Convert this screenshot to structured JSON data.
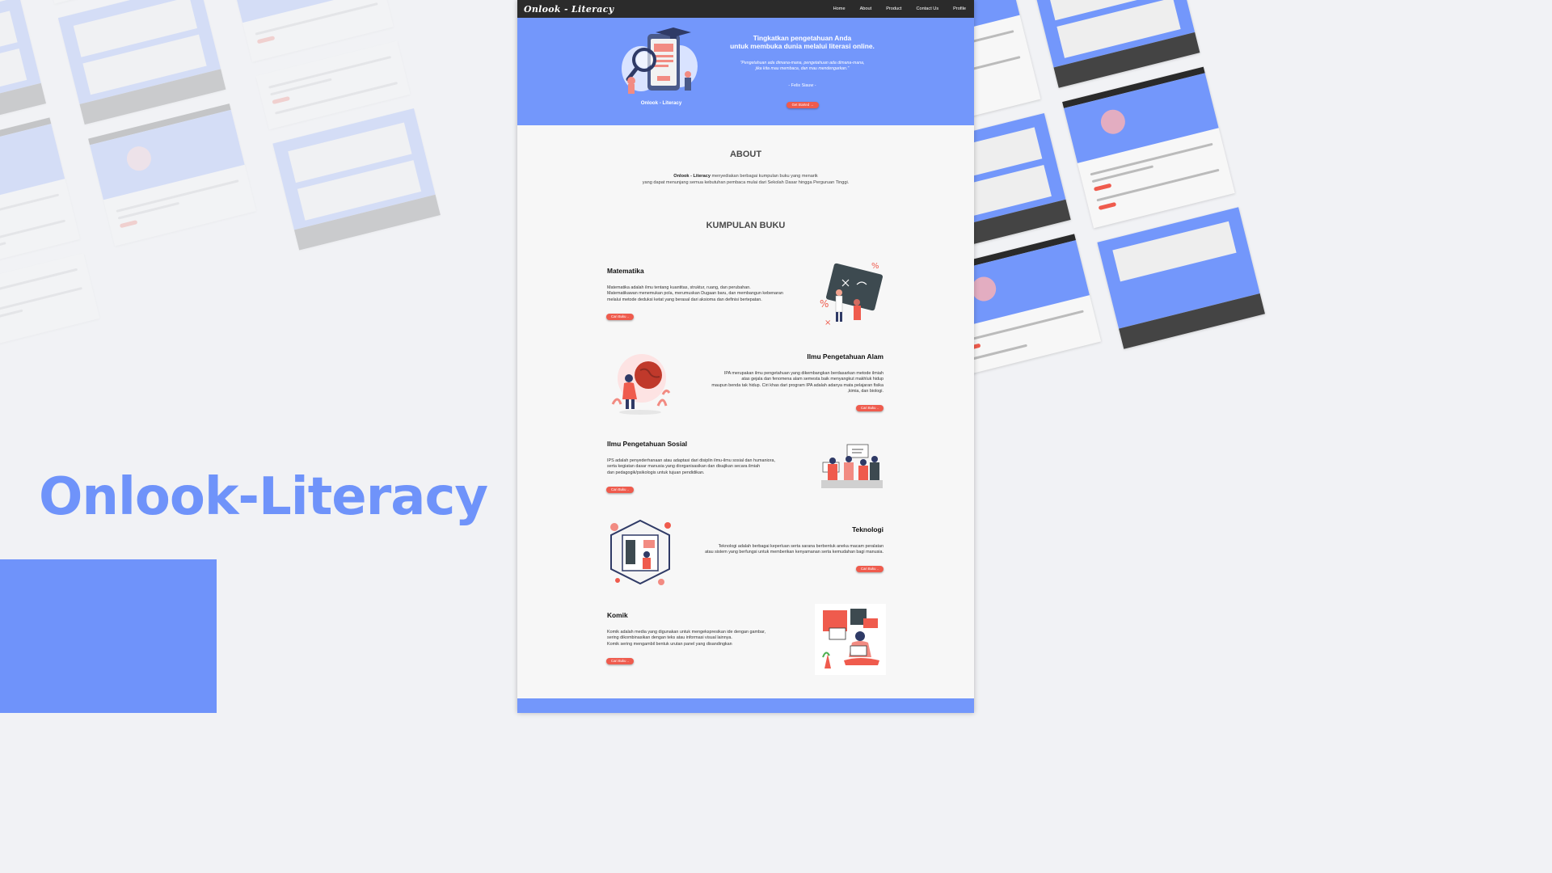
{
  "showcase": {
    "title": "Onlook-Literacy",
    "accent_color": "#6f93fa"
  },
  "nav": {
    "logo": "Onlook - Literacy",
    "links": [
      "Home",
      "About",
      "Product",
      "Contact Us",
      "Profile"
    ]
  },
  "hero": {
    "headline_line1": "Tingkatkan pengetahuan Anda",
    "headline_line2": "untuk membuka dunia melalui literasi online.",
    "quote_line1": "\"Pengetahuan ada dimana-mana, pengetahuan ada dimana-mana,",
    "quote_line2": "jika kita mau membaca, dan mau mendengarkan.\"",
    "author": "- Felix Siauw -",
    "caption": "Onlook - Literacy",
    "button": "Get Started →",
    "illustration_icon": "reading-search-illustration"
  },
  "about": {
    "title": "ABOUT",
    "brand": "Onlook - Literacy",
    "text_line1": " menyediakan berbagai kumpulan buku yang menarik",
    "text_line2": "yang dapat menunjang semua kebutuhan pembaca mulai dari Sekolah Dasar hingga Perguruan Tinggi."
  },
  "books": {
    "title": "KUMPULAN BUKU",
    "items": [
      {
        "title": "Matematika",
        "lines": [
          "Matematika adalah ilmu tentang kuantitas, struktur, ruang, dan perubahan.",
          "Matematikawan menemukan pola, merumuskan Dugaan baru, dan membangun kebenaran",
          "melalui metode deduksi ketat yang berasal dari aksioma dan definisi bertepatan."
        ],
        "button": "Cari Buku ..",
        "icon": "math-blackboard-icon"
      },
      {
        "title": "Ilmu Pengetahuan Alam",
        "lines": [
          "IPA merupakan ilmu pengetahuan yang dikembangkan berdasarkan metode ilmiah",
          "atas gejala dan fenomena alam semesta baik menyangkut makhluk hidup",
          "maupun benda tak hidup. Ciri khas dari program IPA adalah adanya mata pelajaran fisika",
          ",kimia, dan biologi."
        ],
        "button": "Cari Buku ..",
        "icon": "globe-science-icon"
      },
      {
        "title": "Ilmu Pengetahuan Sosial",
        "lines": [
          "IPS adalah penyederhanaan atau adaptasi dari disiplin ilmu-ilmu sosial dan humaniora,",
          "serta kegiatan dasar manusia yang diorganisasikan dan disajikan secara ilmiah",
          "dan pedagogik/psikologis untuk tujuan pendidikan."
        ],
        "button": "Cari Buku ..",
        "icon": "social-protest-icon"
      },
      {
        "title": "Teknologi",
        "lines": [
          "Teknologi adalah berbagai keperluan serta sarana berbentuk aneka macam peralatan",
          "atau sistem yang berfungsi untuk memberikan kenyamanan serta kemudahan bagi manusia."
        ],
        "button": "Cari Buku ..",
        "icon": "technology-device-icon"
      },
      {
        "title": "Komik",
        "lines": [
          "Komik adalah media yang digunakan untuk mengekspresikan ide dengan gambar,",
          "sering dikombinasikan dengan teks atau informasi visual lainnya.",
          "Komik sering mengambil bentuk urutan panel yang disandingkan"
        ],
        "button": "Cari Buku ..",
        "icon": "comic-reader-icon"
      }
    ]
  }
}
